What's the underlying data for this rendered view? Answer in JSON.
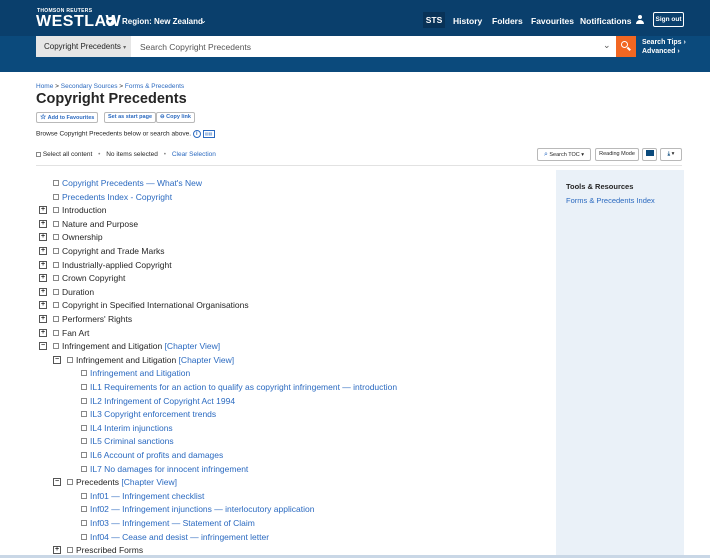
{
  "header": {
    "brand_small": "THOMSON REUTERS",
    "brand": "WESTLAW",
    "region": "Region: New Zealand",
    "nav": [
      "STS",
      "History",
      "Folders",
      "Favourites",
      "Notifications"
    ],
    "sign_out": "Sign out"
  },
  "search": {
    "scope": "Copyright Precedents",
    "placeholder": "Search Copyright Precedents",
    "tips": "Search Tips ›",
    "advanced": "Advanced ›"
  },
  "breadcrumb": {
    "home": "Home",
    "secondary": "Secondary Sources",
    "forms": "Forms & Precedents"
  },
  "page_title": "Copyright Precedents",
  "actions": {
    "favourites": "Add to Favourites",
    "start_page": "Set as start page",
    "copy_link": "Copy link"
  },
  "browse_text": "Browse Copyright Precedents below or search above.",
  "selection": {
    "select_all": "Select all content",
    "none_selected": "No items selected",
    "clear": "Clear Selection"
  },
  "toolbar": {
    "search_toc": "Search TOC",
    "reading_mode": "Reading Mode"
  },
  "toc": [
    {
      "text": "Copyright Precedents — What's New",
      "link": true,
      "indent": 0,
      "expander": ""
    },
    {
      "text": "Precedents Index - Copyright",
      "link": true,
      "indent": 0,
      "expander": ""
    },
    {
      "text": "Introduction",
      "link": false,
      "indent": 0,
      "expander": "+"
    },
    {
      "text": "Nature and Purpose",
      "link": false,
      "indent": 0,
      "expander": "+"
    },
    {
      "text": "Ownership",
      "link": false,
      "indent": 0,
      "expander": "+"
    },
    {
      "text": "Copyright and Trade Marks",
      "link": false,
      "indent": 0,
      "expander": "+"
    },
    {
      "text": "Industrially-applied Copyright",
      "link": false,
      "indent": 0,
      "expander": "+"
    },
    {
      "text": "Crown Copyright",
      "link": false,
      "indent": 0,
      "expander": "+"
    },
    {
      "text": "Duration",
      "link": false,
      "indent": 0,
      "expander": "+"
    },
    {
      "text": "Copyright in Specified International Organisations",
      "link": false,
      "indent": 0,
      "expander": "+"
    },
    {
      "text": "Performers' Rights",
      "link": false,
      "indent": 0,
      "expander": "+"
    },
    {
      "text": "Fan Art",
      "link": false,
      "indent": 0,
      "expander": "+"
    },
    {
      "text": "Infringement and Litigation",
      "link": false,
      "indent": 0,
      "expander": "−",
      "chapter": "[Chapter View]"
    },
    {
      "text": "Infringement and Litigation",
      "link": false,
      "indent": 1,
      "expander": "−",
      "chapter": "[Chapter View]"
    },
    {
      "text": "Infringement and Litigation",
      "link": true,
      "indent": 2,
      "expander": ""
    },
    {
      "text": "IL1 Requirements for an action to qualify as copyright infringement — introduction",
      "link": true,
      "indent": 2,
      "expander": ""
    },
    {
      "text": "IL2 Infringement of Copyright Act 1994",
      "link": true,
      "indent": 2,
      "expander": ""
    },
    {
      "text": "IL3 Copyright enforcement trends",
      "link": true,
      "indent": 2,
      "expander": ""
    },
    {
      "text": "IL4 Interim injunctions",
      "link": true,
      "indent": 2,
      "expander": ""
    },
    {
      "text": "IL5 Criminal sanctions",
      "link": true,
      "indent": 2,
      "expander": ""
    },
    {
      "text": "IL6 Account of profits and damages",
      "link": true,
      "indent": 2,
      "expander": ""
    },
    {
      "text": "IL7 No damages for innocent infringement",
      "link": true,
      "indent": 2,
      "expander": ""
    },
    {
      "text": "Precedents",
      "link": false,
      "indent": 1,
      "expander": "−",
      "chapter": "[Chapter View]"
    },
    {
      "text": "Inf01 — Infringement checklist",
      "link": true,
      "indent": 2,
      "expander": ""
    },
    {
      "text": "Inf02 — Infringement injunctions — interlocutory application",
      "link": true,
      "indent": 2,
      "expander": ""
    },
    {
      "text": "Inf03 — Infringement — Statement of Claim",
      "link": true,
      "indent": 2,
      "expander": ""
    },
    {
      "text": "Inf04 — Cease and desist — infringement letter",
      "link": true,
      "indent": 2,
      "expander": ""
    },
    {
      "text": "Prescribed Forms",
      "link": false,
      "indent": 1,
      "expander": "+"
    }
  ],
  "tools": {
    "heading": "Tools & Resources",
    "link": "Forms & Precedents Index"
  }
}
